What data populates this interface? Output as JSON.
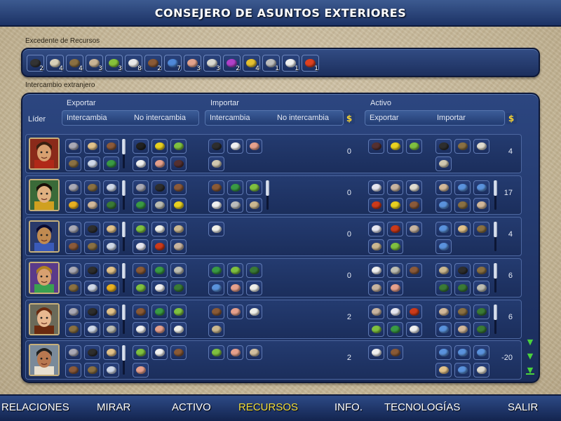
{
  "title": "CONSEJERO DE ASUNTOS EXTERIORES",
  "surplus": {
    "label": "Excedente de Recursos",
    "items": [
      {
        "icon": "coal-icon",
        "color": "#333333",
        "count": "2"
      },
      {
        "icon": "cloth-icon",
        "color": "#d8d0b8",
        "count": "4"
      },
      {
        "icon": "cart-icon",
        "color": "#8a7042",
        "count": "4"
      },
      {
        "icon": "shell-icon",
        "color": "#c8b495",
        "count": "3"
      },
      {
        "icon": "wheat-icon",
        "color": "#86c13a",
        "count": "3"
      },
      {
        "icon": "cow-icon",
        "color": "#e9e9e9",
        "count": "8"
      },
      {
        "icon": "horse-icon",
        "color": "#8a5a36",
        "count": "2"
      },
      {
        "icon": "fish-icon",
        "color": "#4f88d8",
        "count": "7"
      },
      {
        "icon": "pig-icon",
        "color": "#e2a28c",
        "count": "3"
      },
      {
        "icon": "stone-icon",
        "color": "#d9d9d0",
        "count": "3"
      },
      {
        "icon": "dye-icon",
        "color": "#b040c8",
        "count": "2"
      },
      {
        "icon": "gold-icon",
        "color": "#e4c030",
        "count": "4"
      },
      {
        "icon": "sheep-icon",
        "color": "#bdbdbd",
        "count": "1"
      },
      {
        "icon": "mask-icon",
        "color": "#f0f0f0",
        "count": "1"
      },
      {
        "icon": "record-icon",
        "color": "#dd4020",
        "count": "1"
      }
    ]
  },
  "foreign_label": "Intercambio extranjero",
  "headers": {
    "leader": "Líder",
    "export": "Exportar",
    "import": "Importar",
    "active": "Activo",
    "trade": "Intercambia",
    "no_trade": "No intercambia",
    "export_sub": "Exportar",
    "import_sub": "Importar",
    "gold": "$"
  },
  "resource_colors": {
    "lamp": "#a9a9b5",
    "cloth": "#e2c28a",
    "cow": "#8b5a3a",
    "cart": "#8a7042",
    "salt": "#cfd8e8",
    "gem": "#3a9a44",
    "fur": "#222222",
    "banana": "#e8d020",
    "wheat": "#7fc040",
    "cattle": "#f0f0f0",
    "pig": "#e6a08c",
    "wine": "#553030",
    "coal": "#2e2e2e",
    "horse": "#8a5a36",
    "white": "#efefe8",
    "fountain": "#d0c8b0",
    "idol": "#e8b020",
    "fish": "#5a92dc",
    "shell": "#d2b89a",
    "spider": "#3a7a36",
    "stone": "#bdbdb2",
    "record": "#cc3a1a",
    "mask": "#e6e6f0",
    "dust": "#c8b4a0",
    "scroll": "#cbb890",
    "sheep": "#bcbcbc",
    "bone": "#d2c0a0",
    "rice": "#e0dcd0"
  },
  "leaders": [
    {
      "name": "leader-1",
      "gold": "0",
      "active_gold": "4",
      "export_trade": [
        [
          "lamp",
          "cloth",
          "cow"
        ],
        [
          "cart",
          "salt",
          "gem"
        ]
      ],
      "export_no": [
        [
          "fur",
          "banana",
          "wheat"
        ],
        [
          "cattle",
          "pig",
          "wine"
        ]
      ],
      "import_trade": [
        [
          "coal",
          "cattle",
          "pig"
        ],
        [
          "fountain"
        ]
      ],
      "import_no": [],
      "active_export": [
        [
          "wine",
          "banana",
          "wheat"
        ]
      ],
      "active_import": [
        [
          "coal",
          "cart",
          "rice"
        ],
        [
          "fountain"
        ]
      ]
    },
    {
      "name": "leader-2",
      "gold": "0",
      "active_gold": "17",
      "export_trade": [
        [
          "lamp",
          "cart",
          "salt"
        ],
        [
          "idol",
          "shell",
          "spider"
        ]
      ],
      "export_no": [
        [
          "lamp",
          "coal",
          "cow"
        ],
        [
          "gem",
          "stone",
          "banana"
        ]
      ],
      "import_trade": [
        [
          "horse",
          "gem",
          "wheat"
        ],
        [
          "cattle",
          "sheep",
          "scroll"
        ]
      ],
      "import_no": [],
      "active_export": [
        [
          "mask",
          "dust",
          "rice"
        ],
        [
          "record",
          "banana",
          "cow"
        ]
      ],
      "active_import": [
        [
          "shell",
          "fish",
          "fish"
        ],
        [
          "fish",
          "cart",
          "shell"
        ]
      ]
    },
    {
      "name": "leader-3",
      "gold": "0",
      "active_gold": "4",
      "export_trade": [
        [
          "lamp",
          "coal",
          "cloth"
        ],
        [
          "cow",
          "cart",
          "salt"
        ]
      ],
      "export_no": [
        [
          "wheat",
          "white",
          "scroll"
        ],
        [
          "mask",
          "record",
          "dust"
        ]
      ],
      "import_trade": [
        [
          "white"
        ]
      ],
      "import_no": [],
      "active_export": [
        [
          "mask",
          "record",
          "dust"
        ],
        [
          "scroll",
          "wheat"
        ]
      ],
      "active_import": [
        [
          "fish",
          "cloth",
          "cart"
        ],
        [
          "fish"
        ]
      ]
    },
    {
      "name": "leader-4",
      "gold": "0",
      "active_gold": "6",
      "export_trade": [
        [
          "lamp",
          "coal",
          "cloth"
        ],
        [
          "cart",
          "salt",
          "idol"
        ]
      ],
      "export_no": [
        [
          "horse",
          "gem",
          "stone"
        ],
        [
          "wheat",
          "cattle",
          "spider"
        ]
      ],
      "import_trade": [
        [
          "gem",
          "wheat",
          "spider"
        ],
        [
          "fish",
          "pig",
          "white"
        ]
      ],
      "import_no": [],
      "active_export": [
        [
          "cattle",
          "stone",
          "cow"
        ],
        [
          "dust",
          "pig"
        ]
      ],
      "active_import": [
        [
          "scroll",
          "coal",
          "cart"
        ],
        [
          "spider",
          "spider",
          "stone"
        ]
      ]
    },
    {
      "name": "leader-5",
      "gold": "2",
      "active_gold": "6",
      "export_trade": [
        [
          "lamp",
          "coal",
          "cloth"
        ],
        [
          "cart",
          "salt",
          "stone"
        ]
      ],
      "export_no": [
        [
          "horse",
          "gem",
          "wheat"
        ],
        [
          "cattle",
          "pig",
          "white"
        ]
      ],
      "import_trade": [
        [
          "horse",
          "pig",
          "white"
        ],
        [
          "scroll"
        ]
      ],
      "import_no": [],
      "active_export": [
        [
          "dust",
          "mask",
          "record"
        ],
        [
          "wheat",
          "gem",
          "cattle"
        ]
      ],
      "active_import": [
        [
          "shell",
          "cart",
          "spider"
        ],
        [
          "fish",
          "shell",
          "spider"
        ]
      ]
    },
    {
      "name": "leader-6",
      "gold": "2",
      "active_gold": "-20",
      "export_trade": [
        [
          "lamp",
          "coal",
          "cloth"
        ],
        [
          "cow",
          "cart",
          "salt"
        ]
      ],
      "export_no": [
        [
          "wheat",
          "cattle",
          "horse"
        ],
        [
          "pig"
        ]
      ],
      "import_trade": [
        [
          "wheat",
          "pig",
          "bone"
        ]
      ],
      "import_no": [],
      "active_export": [
        [
          "cattle",
          "horse"
        ]
      ],
      "active_import": [
        [
          "fish",
          "fish",
          "fish"
        ],
        [
          "cloth",
          "fish",
          "rice"
        ]
      ]
    }
  ],
  "nav": [
    {
      "label": "RELACIONES",
      "active": false
    },
    {
      "label": "MIRAR",
      "active": false
    },
    {
      "label": "ACTIVO",
      "active": false
    },
    {
      "label": "RECURSOS",
      "active": true
    },
    {
      "label": "INFO.",
      "active": false
    },
    {
      "label": "TECNOLOGÍAS",
      "active": false
    },
    {
      "label": "SALIR",
      "active": false
    }
  ],
  "portraits": [
    {
      "bg": "#8a2a1a",
      "skin": "#d8a070",
      "hair": "#3a2010",
      "hat": "#b02818"
    },
    {
      "bg": "#3a6a38",
      "skin": "#e0b080",
      "hair": "#1a1008",
      "hat": "#d0a020"
    },
    {
      "bg": "#2a3a6a",
      "skin": "#c08a50",
      "hair": "#0a0a30",
      "hat": "#3a5ab8"
    },
    {
      "bg": "#5a3a8a",
      "skin": "#d8a070",
      "hair": "#b08020",
      "hat": "#3aa050"
    },
    {
      "bg": "#6a6a5a",
      "skin": "#e8b890",
      "hair": "#6a2a10",
      "hat": "#6a2a10"
    },
    {
      "bg": "#7a8a9a",
      "skin": "#b87850",
      "hair": "#202020",
      "hat": "#e8e0d0"
    }
  ]
}
